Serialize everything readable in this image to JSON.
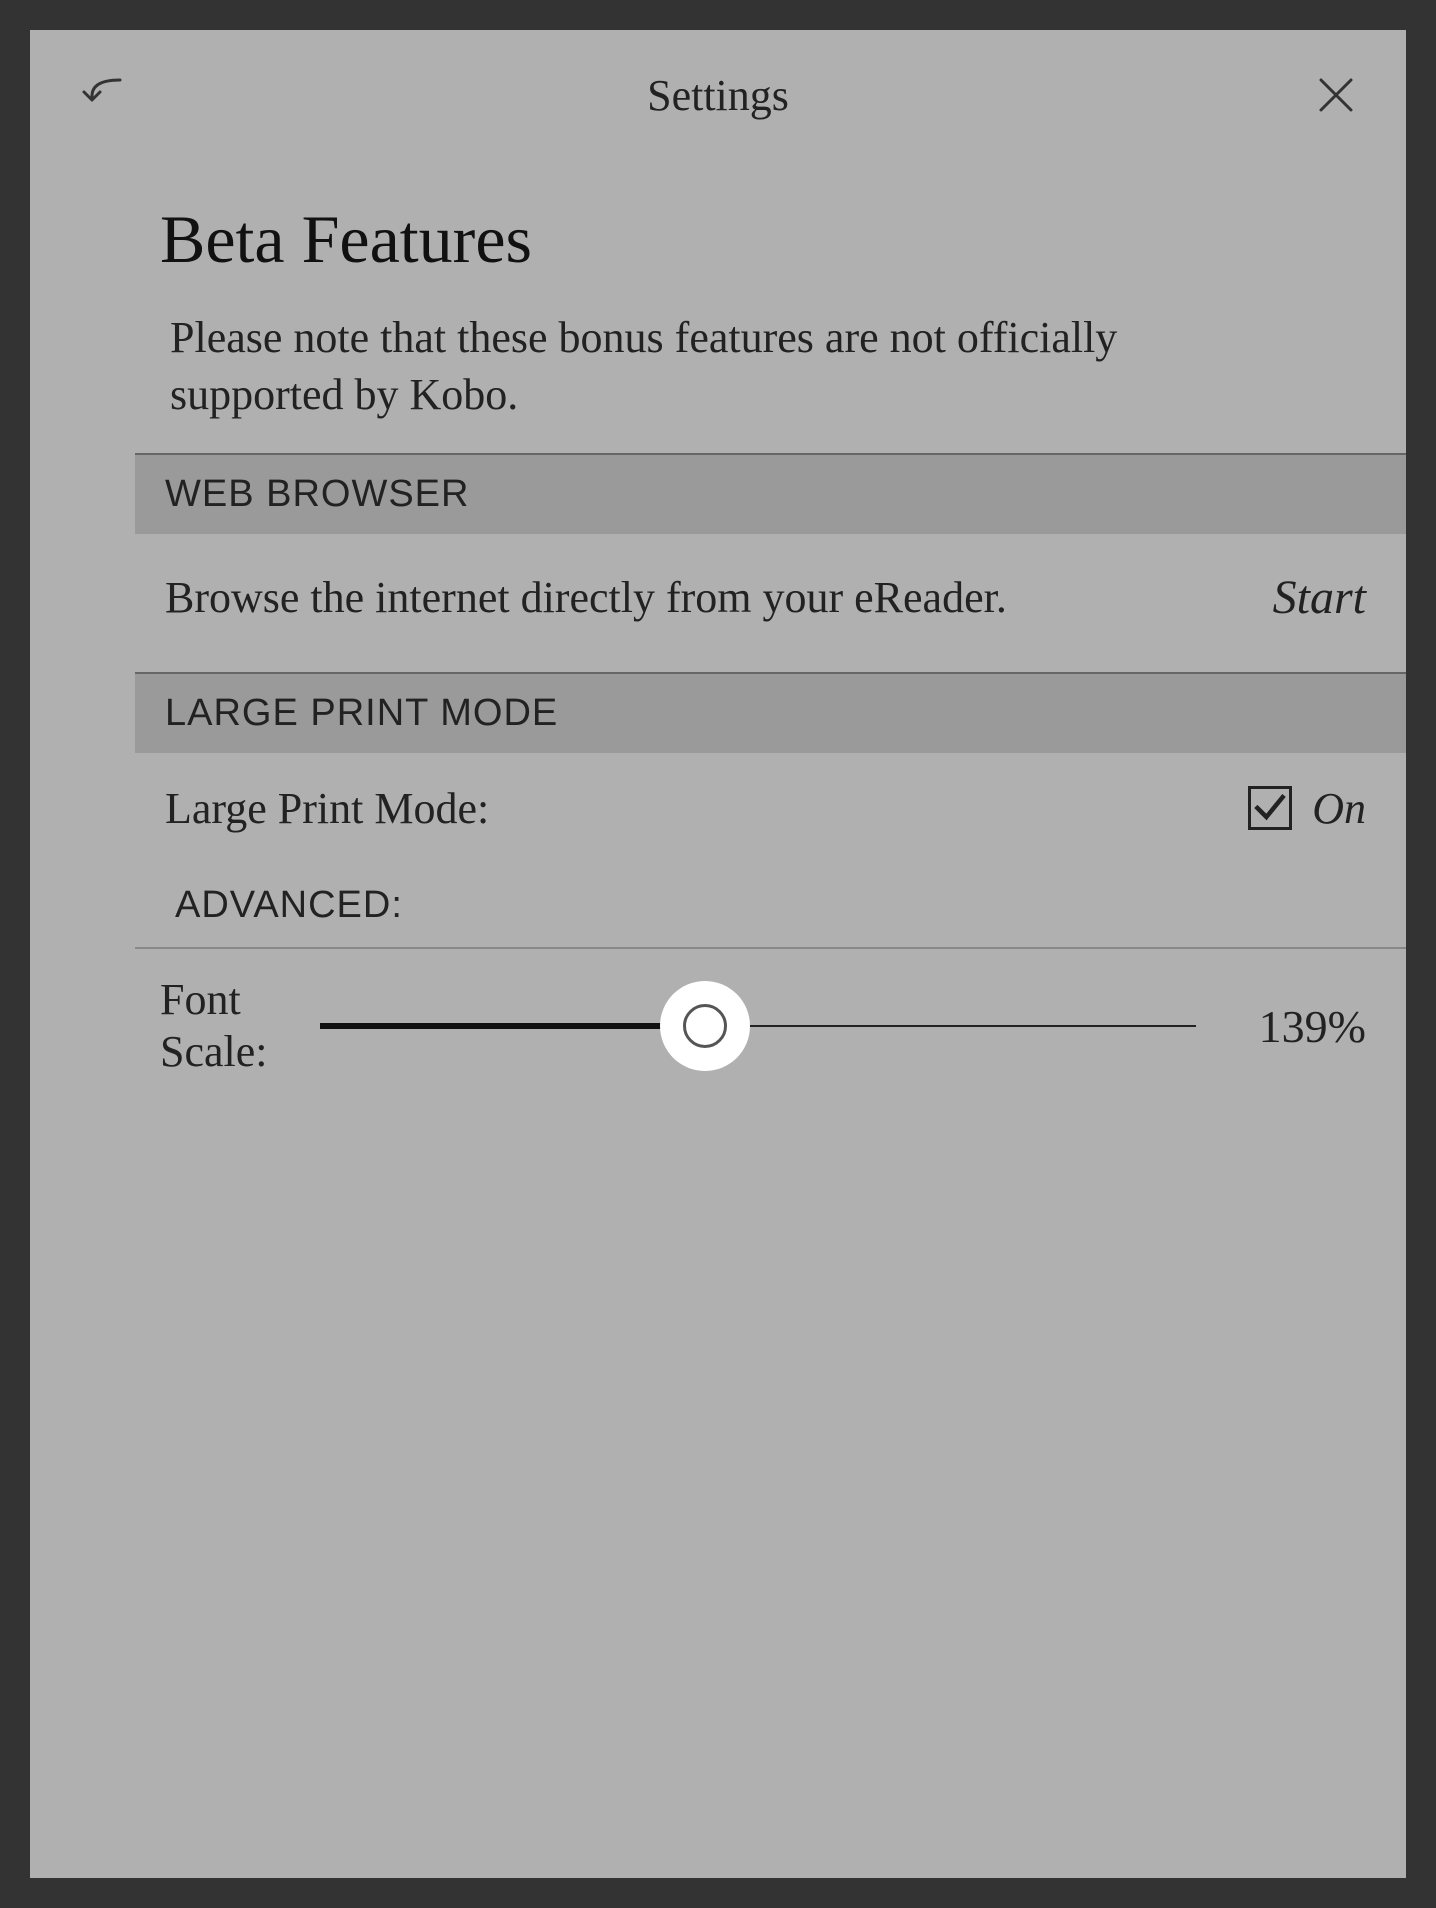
{
  "header": {
    "title": "Settings"
  },
  "page": {
    "title": "Beta Features",
    "subtitle": "Please note that these bonus features are not officially supported by Kobo."
  },
  "sections": {
    "webBrowser": {
      "header": "WEB BROWSER",
      "description": "Browse the internet directly from your eReader.",
      "action": "Start"
    },
    "largePrint": {
      "header": "LARGE PRINT MODE",
      "toggleLabel": "Large Print Mode:",
      "toggleState": "On",
      "toggleChecked": true,
      "advancedLabel": "ADVANCED:",
      "slider": {
        "label": "Font Scale:",
        "value": "139%",
        "percent": 44
      }
    }
  }
}
